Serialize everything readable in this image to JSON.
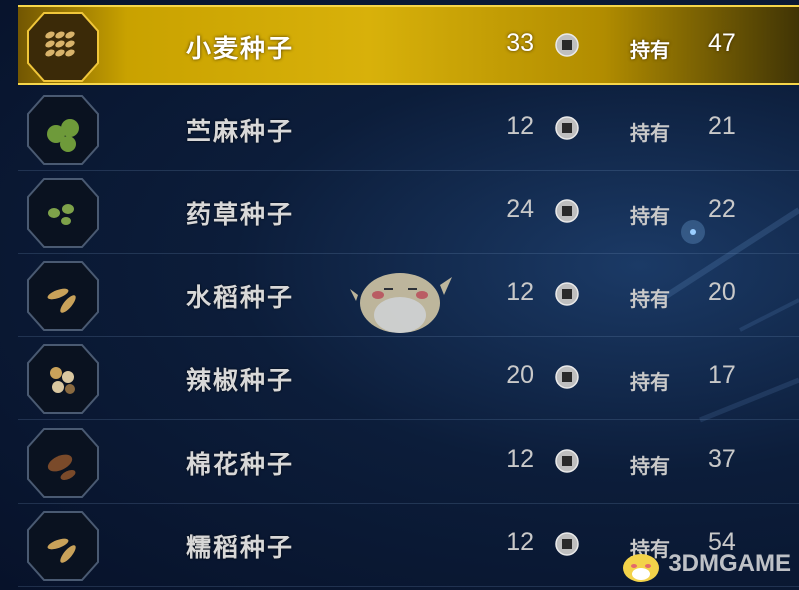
{
  "items": [
    {
      "name": "小麦种子",
      "price": "33",
      "held_label": "持有",
      "held": "47",
      "icon": "wheat-seeds-icon",
      "selected": true
    },
    {
      "name": "苎麻种子",
      "price": "12",
      "held_label": "持有",
      "held": "21",
      "icon": "ramie-seeds-icon",
      "selected": false
    },
    {
      "name": "药草种子",
      "price": "24",
      "held_label": "持有",
      "held": "22",
      "icon": "herb-seeds-icon",
      "selected": false
    },
    {
      "name": "水稻种子",
      "price": "12",
      "held_label": "持有",
      "held": "20",
      "icon": "rice-seeds-icon",
      "selected": false
    },
    {
      "name": "辣椒种子",
      "price": "20",
      "held_label": "持有",
      "held": "17",
      "icon": "chili-seeds-icon",
      "selected": false
    },
    {
      "name": "棉花种子",
      "price": "12",
      "held_label": "持有",
      "held": "37",
      "icon": "cotton-seeds-icon",
      "selected": false
    },
    {
      "name": "糯稻种子",
      "price": "12",
      "held_label": "持有",
      "held": "54",
      "icon": "glutinous-rice-seeds-icon",
      "selected": false
    }
  ],
  "currency_icon": "coin-icon",
  "watermark": {
    "text": "3DMGAME"
  },
  "colors": {
    "highlight": "#d8b10a",
    "background": "#0c1d3a",
    "text": "#c9c9c9"
  }
}
